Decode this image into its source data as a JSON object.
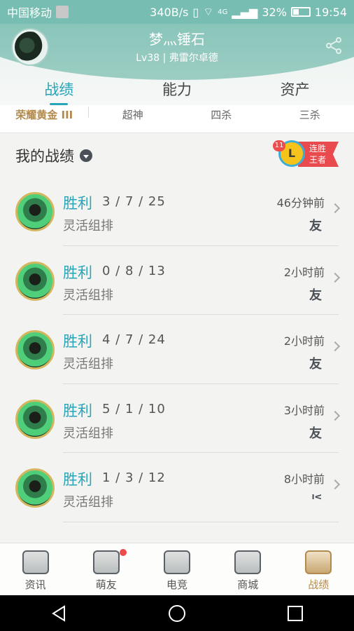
{
  "status_bar": {
    "carrier": "中国移动",
    "speed": "340B/s",
    "network": "4G",
    "battery": "32%",
    "time": "19:54"
  },
  "header": {
    "nickname": "梦灬锤石",
    "level": "Lv38 | 弗雷尔卓德",
    "share_icon": "share-icon"
  },
  "tabs": [
    {
      "label": "战绩",
      "active": true
    },
    {
      "label": "能力"
    },
    {
      "label": "资产"
    }
  ],
  "subtabs": [
    {
      "label": "荣耀黄金 III"
    },
    {
      "label": "超神"
    },
    {
      "label": "四杀"
    },
    {
      "label": "三杀"
    }
  ],
  "section": {
    "title": "我的战绩"
  },
  "streak": {
    "count": "11",
    "trophy_letter": "L",
    "line1": "连胜",
    "line2": "王者"
  },
  "matches": [
    {
      "result": "胜利",
      "kda": "3 / 7 / 25",
      "mode": "灵活组排",
      "time": "46分钟前",
      "tag": "友"
    },
    {
      "result": "胜利",
      "kda": "0 / 8 / 13",
      "mode": "灵活组排",
      "time": "2小时前",
      "tag": "友"
    },
    {
      "result": "胜利",
      "kda": "4 / 7 / 24",
      "mode": "灵活组排",
      "time": "2小时前",
      "tag": "友"
    },
    {
      "result": "胜利",
      "kda": "5 / 1 / 10",
      "mode": "灵活组排",
      "time": "3小时前",
      "tag": "友"
    },
    {
      "result": "胜利",
      "kda": "1 / 3 / 12",
      "mode": "灵活组排",
      "time": "8小时前",
      "tag": "ᑊᑉ"
    }
  ],
  "bottom_nav": [
    {
      "label": "资讯",
      "icon": "news-icon"
    },
    {
      "label": "萌友",
      "icon": "friends-icon",
      "notify": true
    },
    {
      "label": "电竞",
      "icon": "esports-icon"
    },
    {
      "label": "商城",
      "icon": "shop-icon"
    },
    {
      "label": "战绩",
      "icon": "records-icon",
      "active": true
    }
  ],
  "colors": {
    "accent": "#27a5b8",
    "header": "#77bdb1",
    "gold": "#b38a4d",
    "notify": "#f04b4b"
  }
}
